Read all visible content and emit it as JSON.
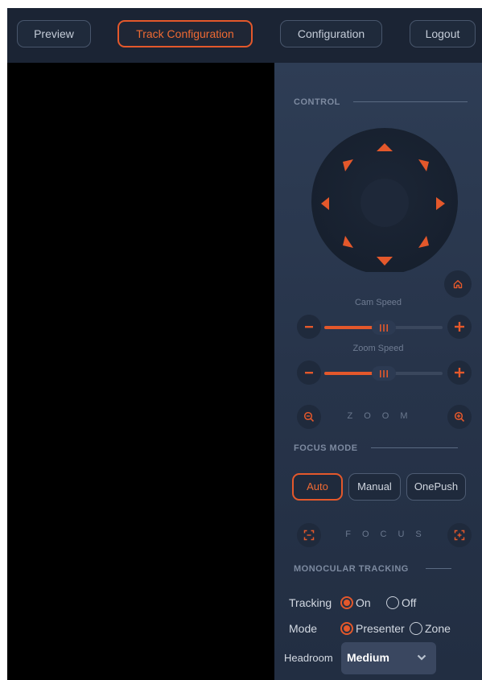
{
  "nav": {
    "preview": "Preview",
    "track_configuration": "Track Configuration",
    "configuration": "Configuration",
    "logout": "Logout",
    "active": "track_configuration"
  },
  "control": {
    "title": "CONTROL",
    "cam_speed_label": "Cam Speed",
    "cam_speed_value": 0.5,
    "zoom_speed_label": "Zoom Speed",
    "zoom_speed_value": 0.5,
    "zoom_label": "ZOOM"
  },
  "focus_mode": {
    "title": "FOCUS MODE",
    "auto": "Auto",
    "manual": "Manual",
    "onepush": "OnePush",
    "selected": "auto",
    "focus_label": "FOCUS"
  },
  "tracking": {
    "title": "MONOCULAR TRACKING",
    "tracking_label": "Tracking",
    "on": "On",
    "off": "Off",
    "tracking_selected": "on",
    "mode_label": "Mode",
    "presenter": "Presenter",
    "zone": "Zone",
    "mode_selected": "presenter",
    "headroom_label": "Headroom",
    "headroom_value": "Medium"
  },
  "colors": {
    "accent": "#e4582b",
    "background": "#1c2535",
    "panel": "#2a3850"
  },
  "icons": [
    "home-icon",
    "zoom-out-icon",
    "zoom-in-icon",
    "focus-near-icon",
    "focus-far-icon",
    "minus-icon",
    "plus-icon",
    "chevron-down-icon"
  ]
}
